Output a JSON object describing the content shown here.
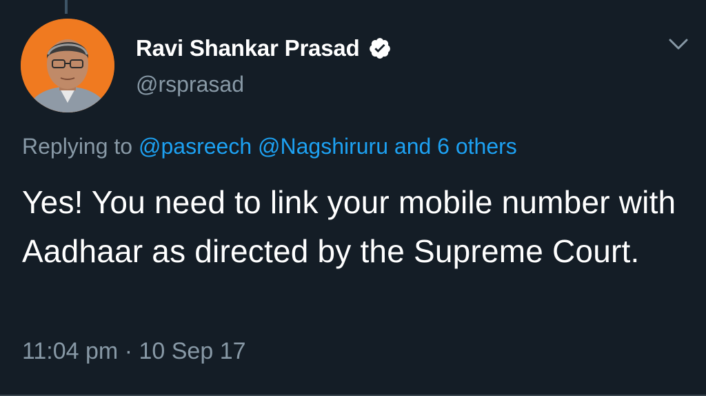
{
  "tweet": {
    "author": {
      "display_name": "Ravi Shankar Prasad",
      "handle": "@rsprasad",
      "verified": true,
      "avatar_icon": "profile-photo"
    },
    "reply": {
      "prefix": "Replying to",
      "mention_1": "@pasreech",
      "mention_2": "@Nagshiruru",
      "others": "and 6 others"
    },
    "text": "Yes! You need to link your mobile number with Aadhaar as directed by the Supreme Court.",
    "time": "11:04 pm",
    "separator": "·",
    "date": "10 Sep 17"
  },
  "colors": {
    "background": "#141d26",
    "primary_text": "#ffffff",
    "secondary_text": "#8899a6",
    "link": "#1da1f2",
    "avatar_bg": "#f07a20"
  },
  "icons": {
    "verified": "verified-badge-icon",
    "menu": "chevron-down-icon"
  }
}
